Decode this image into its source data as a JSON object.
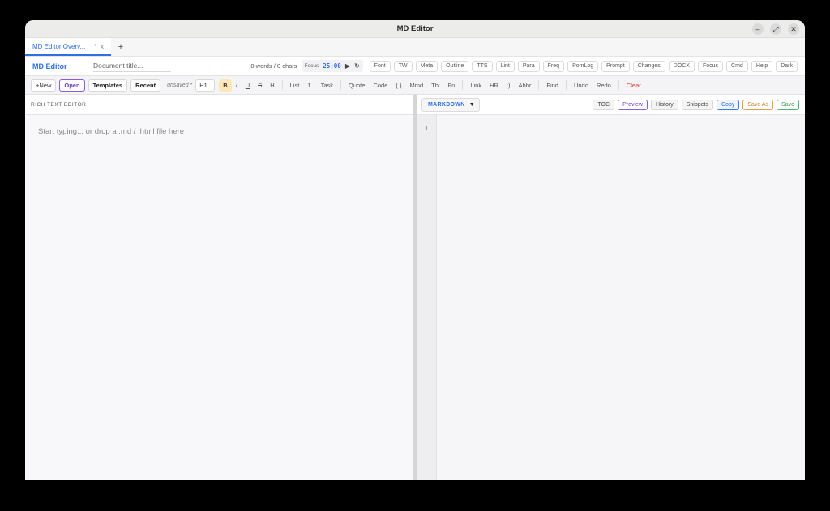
{
  "window": {
    "title": "MD Editor"
  },
  "tabs": [
    {
      "label": "MD Editor Overv...",
      "modified": "*",
      "close": "x"
    }
  ],
  "add_tab": "+",
  "header": {
    "brand": "MD Editor",
    "doc_title_placeholder": "Document title...",
    "counts": "0 words / 0 chars",
    "focus_label": "Focus",
    "timer": "25:00",
    "chips": [
      "Font",
      "TW",
      "Meta",
      "Outline",
      "TTS",
      "Lint",
      "Para",
      "Freq",
      "PomLog",
      "Prompt",
      "Changes",
      "DOCX",
      "Focus",
      "Cmd",
      "Help",
      "Dark"
    ]
  },
  "toolbar": {
    "new": "+New",
    "open": "Open",
    "templates": "Templates",
    "recent": "Recent",
    "unsaved": "unsaved *",
    "heading": "H1",
    "bold": "B",
    "italic": "I",
    "underline": "U",
    "strike": "S",
    "highlight": "H",
    "list": "List",
    "numbered": "1.",
    "task": "Task",
    "quote": "Quote",
    "code": "Code",
    "braces": "{ }",
    "mmd": "Mmd",
    "tbl": "Tbl",
    "fn": "Fn",
    "link": "Link",
    "hr": "HR",
    "emoji": ":)",
    "abbr": "Abbr",
    "find": "Find",
    "undo": "Undo",
    "redo": "Redo",
    "clear": "Clear"
  },
  "left_pane": {
    "heading": "RICH TEXT EDITOR",
    "placeholder": "Start typing... or drop a .md / .html file here"
  },
  "right_pane": {
    "mode": "MARKDOWN",
    "buttons": {
      "toc": "TOC",
      "preview": "Preview",
      "history": "History",
      "snippets": "Snippets",
      "copy": "Copy",
      "save_as": "Save As",
      "save": "Save"
    },
    "line_numbers": [
      "1"
    ]
  },
  "colors": {
    "accent": "#2f6fe0",
    "purple": "#6a3bc2",
    "danger": "#e03030",
    "warning": "#d08020",
    "success": "#2f9a4a"
  }
}
